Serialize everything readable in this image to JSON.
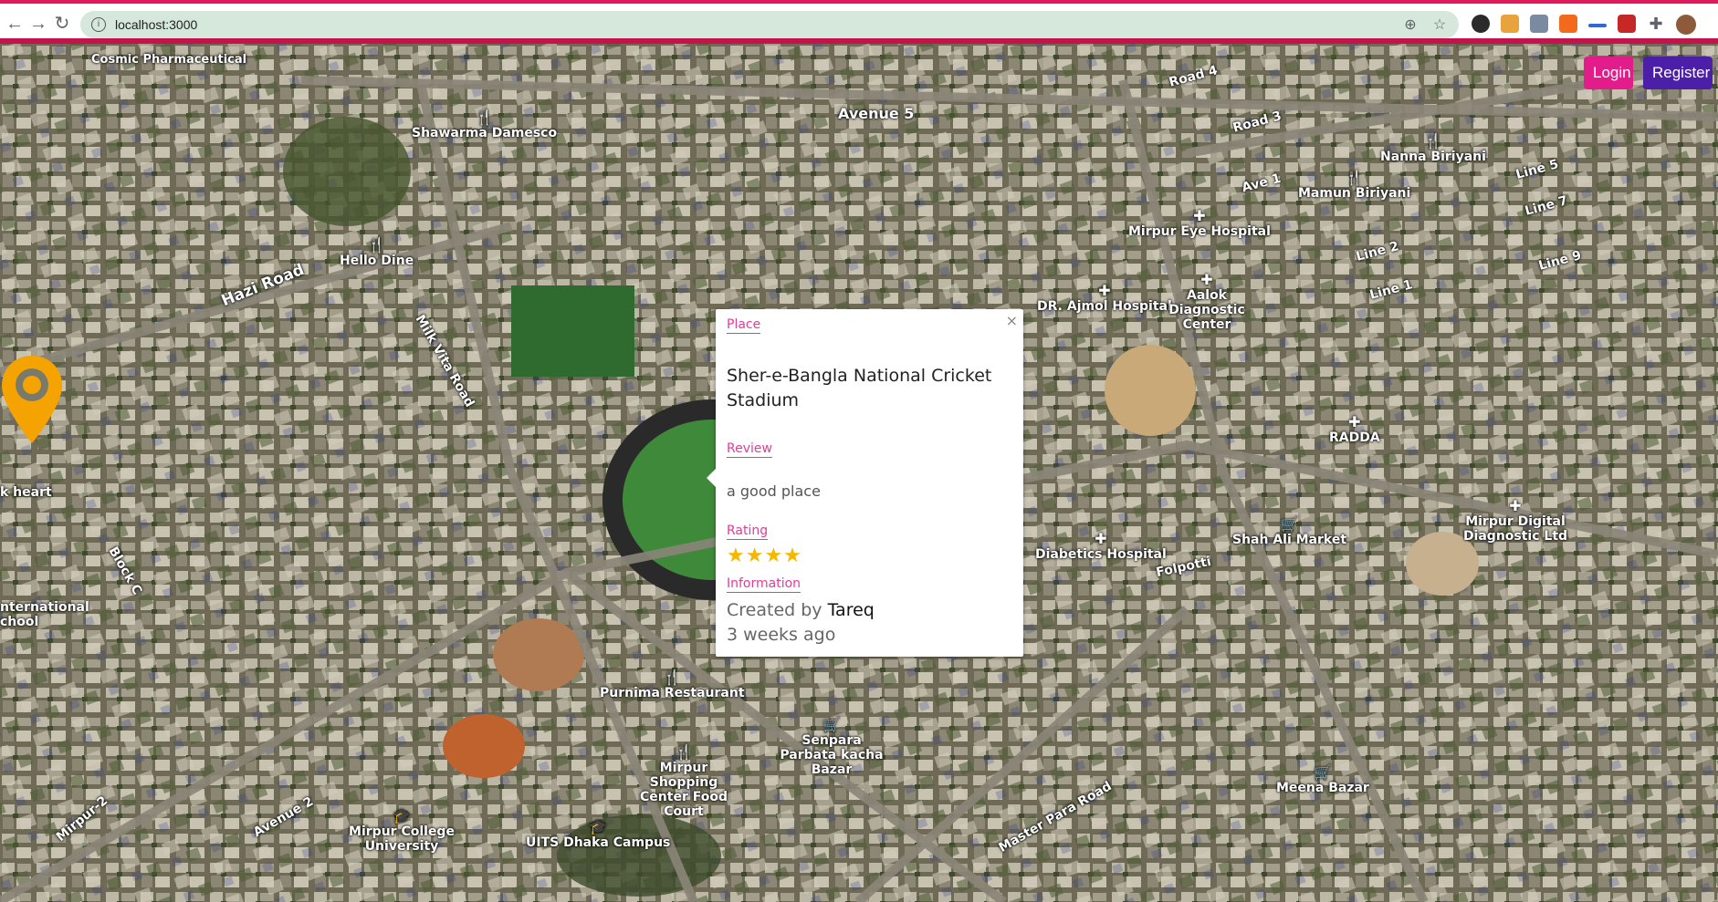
{
  "browser": {
    "url": "localhost:3000",
    "accent_color": "#e0195c"
  },
  "auth": {
    "login_label": "Login",
    "register_label": "Register",
    "login_color": "#e31c8c",
    "register_color": "#4b1fa8"
  },
  "map": {
    "labels": {
      "cosmic": "Cosmic Pharmaceutical",
      "shawarma": "Shawarma Damesco",
      "avenue5": "Avenue 5",
      "road4": "Road 4",
      "road3": "Road 3",
      "nanna": "Nanna Biriyani",
      "line5": "Line 5",
      "line7": "Line 7",
      "ave1": "Ave 1",
      "mamun": "Mamun Biriyani",
      "mirpur_eye": "Mirpur Eye Hospital",
      "hazi_road": "Hazi Road",
      "hello_dine": "Hello Dine",
      "milk_vita": "Milk Vita Road",
      "line2": "Line 2",
      "line9": "Line 9",
      "line1": "Line 1",
      "ajmol": "DR. Ajmol Hospital",
      "aalok": "Aalok Diagnostic Center",
      "radda": "RADDA",
      "k_heart": "k heart",
      "diabetics": "Diabetics Hospital",
      "folpotti": "Folpotti",
      "shah_ali": "Shah Ali Market",
      "mirpur_digital": "Mirpur Digital Diagnostic Ltd",
      "international": "nternational chool",
      "block_c": "Block C",
      "purnima": "Purnima Restaurant",
      "senpara": "Senpara Parbata kacha Bazar",
      "mirpur_shopping": "Mirpur Shopping Center Food Court",
      "meena": "Meena Bazar",
      "master_para": "Master Para Road",
      "avenue2": "Avenue 2",
      "mirpur_college": "Mirpur College University",
      "uits": "UITS Dhaka Campus",
      "mirpur2": "Mirpur-2"
    }
  },
  "popup": {
    "place_heading": "Place",
    "place_name": "Sher-e-Bangla National Cricket Stadium",
    "review_heading": "Review",
    "review_text": "a good place",
    "rating_heading": "Rating",
    "rating_value": 4,
    "rating_stars": "★★★★",
    "info_heading": "Information",
    "created_prefix": "Created by",
    "created_by": "Tareq",
    "time_ago": "3 weeks ago",
    "close_label": "×",
    "accent_color": "#e33b9a"
  },
  "marker": {
    "color": "#f5a300",
    "icon": "map-pin-icon"
  }
}
